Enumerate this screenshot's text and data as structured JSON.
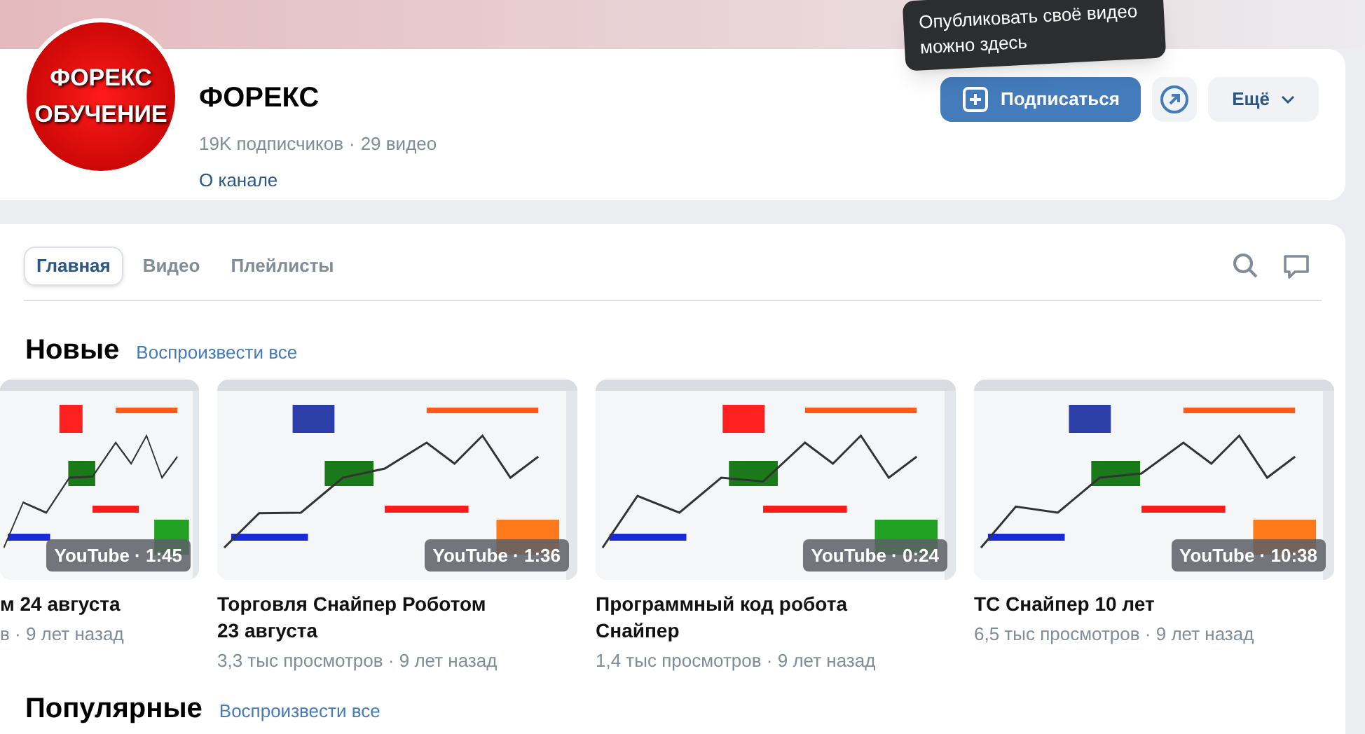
{
  "tooltip": "Опубликовать своё видео можно здесь",
  "channel": {
    "avatar_lines": [
      "ФОРЕКС",
      "ОБУЧЕНИЕ"
    ],
    "name": "ФОРЕКС",
    "subscribers": "19K подписчиков",
    "separator": "·",
    "videos": "29 видео",
    "about": "О канале"
  },
  "actions": {
    "subscribe": "Подписаться",
    "more": "Ещё"
  },
  "tabs": [
    {
      "label": "Главная",
      "selected": true
    },
    {
      "label": "Видео",
      "selected": false
    },
    {
      "label": "Плейлисты",
      "selected": false
    }
  ],
  "sections": [
    {
      "title": "Новые",
      "play_all": "Воспроизвести все",
      "videos": [
        {
          "kind": "partial",
          "badge": "YouTube · 1:45",
          "title": "м 24 августа",
          "meta": "в · 9 лет назад"
        },
        {
          "kind": "full",
          "badge": "YouTube · 1:36",
          "title": "Торговля Снайпер Роботом 23 августа",
          "meta": "3,3 тыс просмотров · 9 лет назад"
        },
        {
          "kind": "full",
          "badge": "YouTube · 0:24",
          "title": "Программный код робота Снайпер",
          "meta": "1,4 тыс просмотров · 9 лет назад"
        },
        {
          "kind": "full",
          "badge": "YouTube · 10:38",
          "title": "ТС Снайпер 10 лет",
          "meta": "6,5 тыс просмотров · 9 лет назад"
        }
      ]
    },
    {
      "title": "Популярные",
      "play_all": "Воспроизвести все"
    }
  ]
}
